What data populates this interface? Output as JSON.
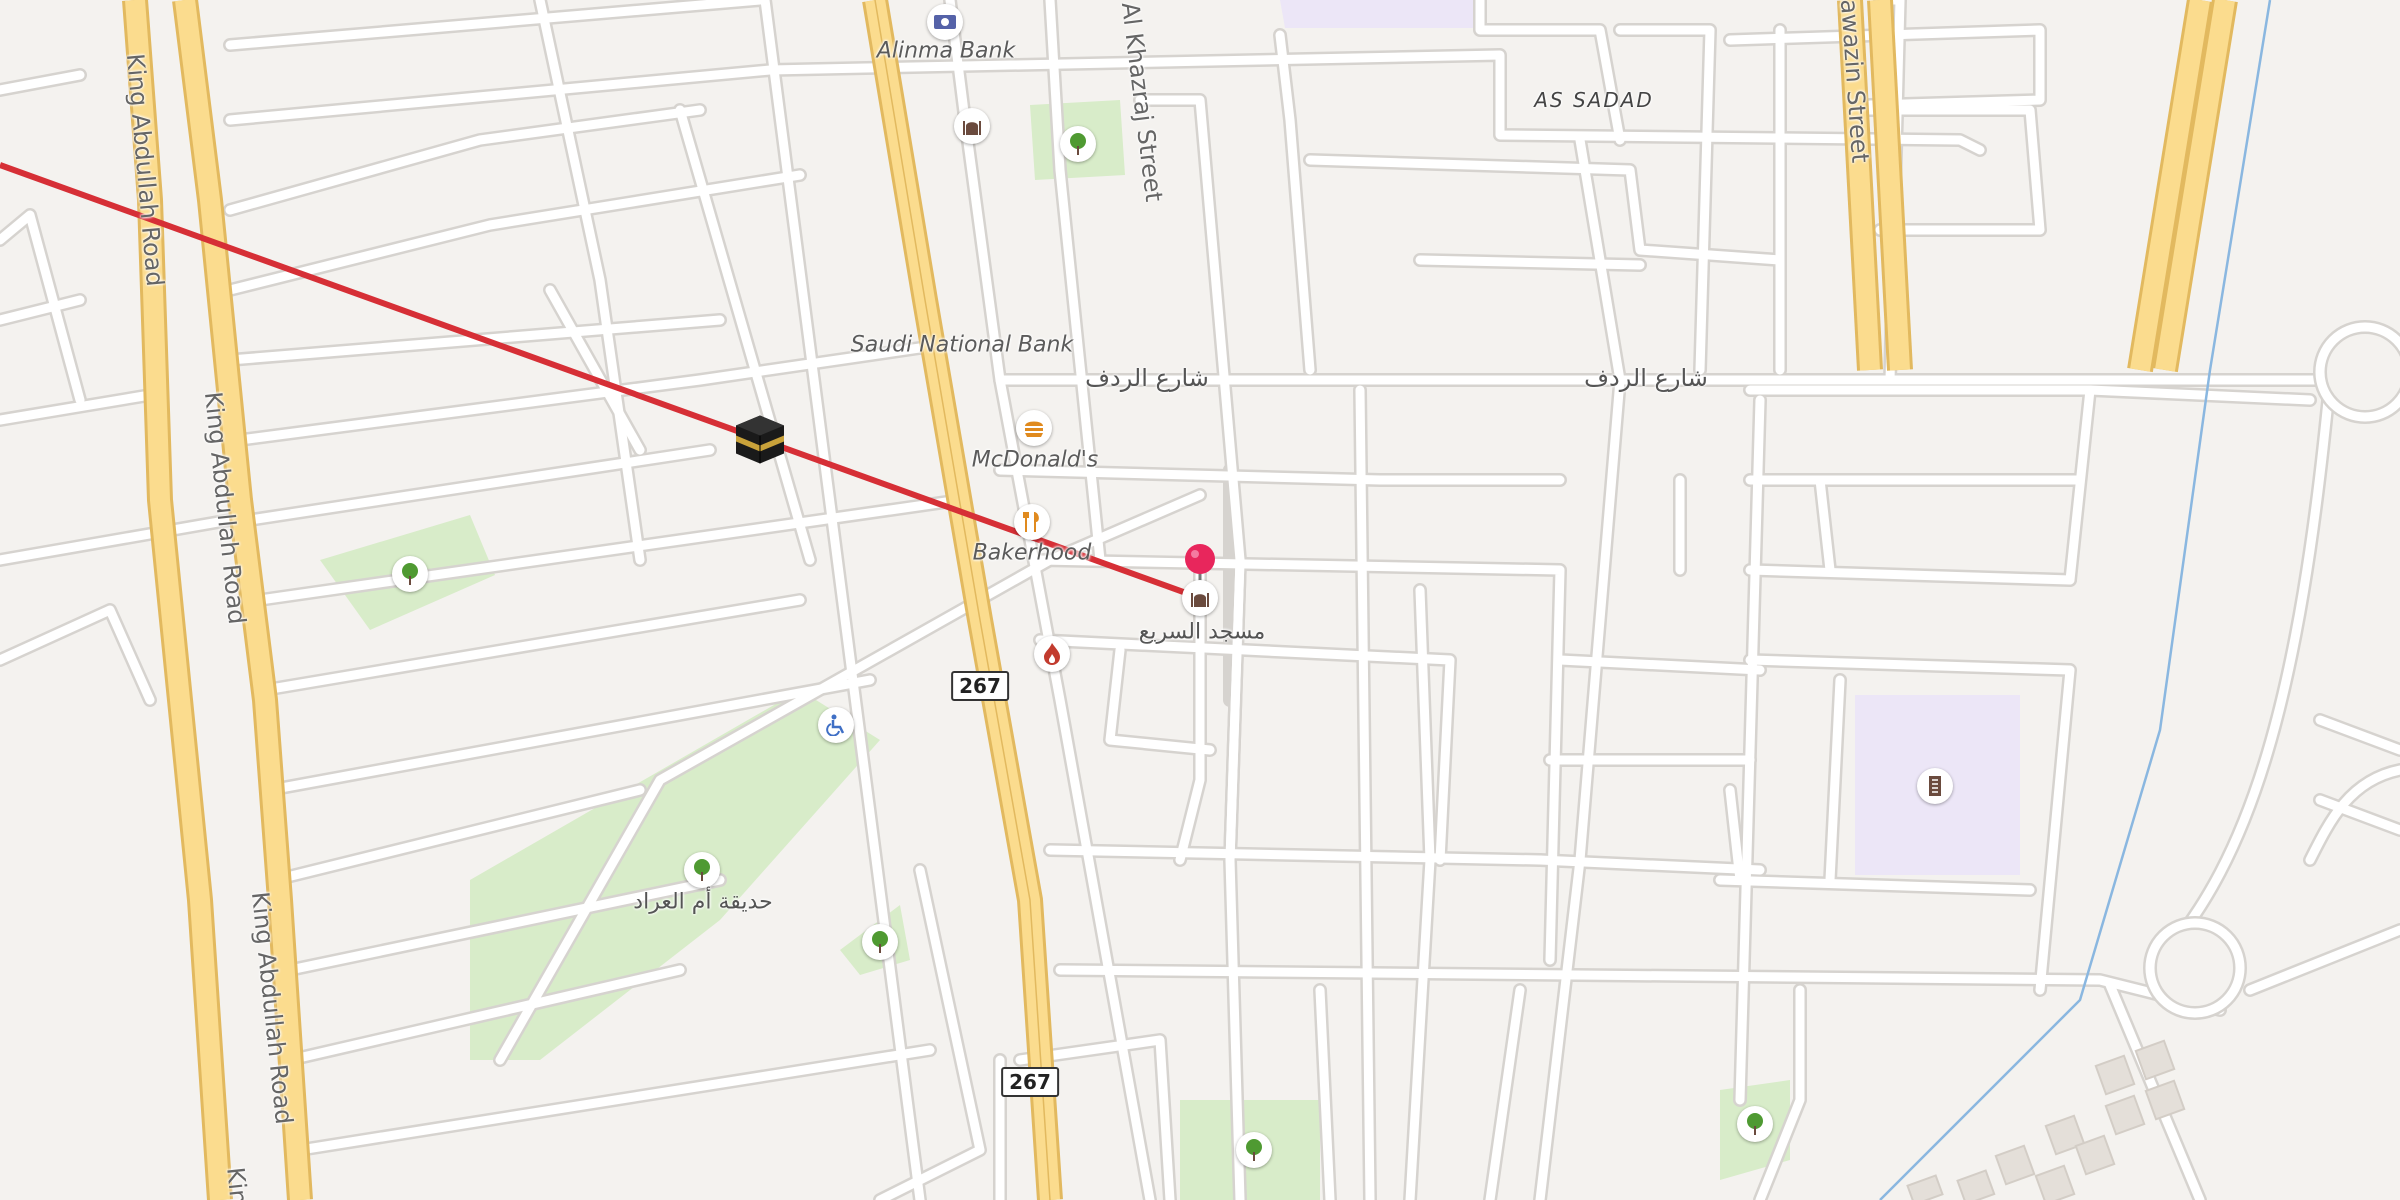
{
  "map": {
    "area_labels": [
      {
        "id": "as-sadad",
        "text": "AS SADAD"
      }
    ],
    "road_labels": [
      {
        "id": "king-abdullah-1",
        "text": "King Abdullah Road"
      },
      {
        "id": "king-abdullah-2",
        "text": "King Abdullah Road"
      },
      {
        "id": "king-abdullah-3",
        "text": "King Abdullah Road"
      },
      {
        "id": "king-abdullah-4",
        "text": "Kin"
      },
      {
        "id": "al-khazraj",
        "text": "Al Khazraj Street"
      },
      {
        "id": "hawazin",
        "text": "Hawazin Street"
      },
      {
        "id": "ardaf-1",
        "text": "شارع الردف"
      },
      {
        "id": "ardaf-2",
        "text": "شارع الردف"
      }
    ],
    "route_shields": [
      {
        "id": "shield-267-a",
        "text": "267"
      },
      {
        "id": "shield-267-b",
        "text": "267"
      }
    ],
    "pois": [
      {
        "id": "alinma-bank",
        "name": "Alinma Bank",
        "icon": "bank-icon",
        "color": "#5562a8"
      },
      {
        "id": "saudi-national-bank",
        "name": "Saudi National Bank",
        "icon": "",
        "color": "#5562a8"
      },
      {
        "id": "mcdonalds",
        "name": "McDonald's",
        "icon": "burger-icon",
        "color": "#e08a1e"
      },
      {
        "id": "bakerhood",
        "name": "Bakerhood",
        "icon": "restaurant-icon",
        "color": "#e08a1e"
      },
      {
        "id": "masjid-alsari",
        "name": "مسجد السريع",
        "icon": "mosque-icon",
        "color": "#6b4b3e"
      },
      {
        "id": "umm-al-arad-park",
        "name": "حديقة أم العراد",
        "icon": "tree-icon",
        "color": "#4f9a32"
      }
    ],
    "unnamed_icons": [
      {
        "id": "mosque-top",
        "icon": "mosque-icon",
        "color": "#6b4b3e"
      },
      {
        "id": "park-1",
        "icon": "tree-icon",
        "color": "#4f9a32"
      },
      {
        "id": "park-2",
        "icon": "tree-icon",
        "color": "#4f9a32"
      },
      {
        "id": "park-3",
        "icon": "tree-icon",
        "color": "#4f9a32"
      },
      {
        "id": "park-4",
        "icon": "tree-icon",
        "color": "#4f9a32"
      },
      {
        "id": "park-5",
        "icon": "tree-icon",
        "color": "#4f9a32"
      },
      {
        "id": "fuel",
        "icon": "fire-icon",
        "color": "#c23b2e"
      },
      {
        "id": "accessibility",
        "icon": "wheelchair-icon",
        "color": "#3f6fc5"
      },
      {
        "id": "school",
        "icon": "school-icon",
        "color": "#6b4b3e"
      }
    ],
    "qibla_line": {
      "color": "#d62f36",
      "target_icon": "kaaba-icon"
    },
    "pin": {
      "icon": "location-pin-icon",
      "color": "#e8265c"
    },
    "colors": {
      "background": "#f4f2ef",
      "minor_road": "#ffffff",
      "road_casing": "#d6d3cf",
      "highway": "#fbdc8e",
      "highway_casing": "#e2b95f",
      "park": "#d8ecc9",
      "school_area": "#ece6f7",
      "water": "#8ab7e0"
    }
  }
}
